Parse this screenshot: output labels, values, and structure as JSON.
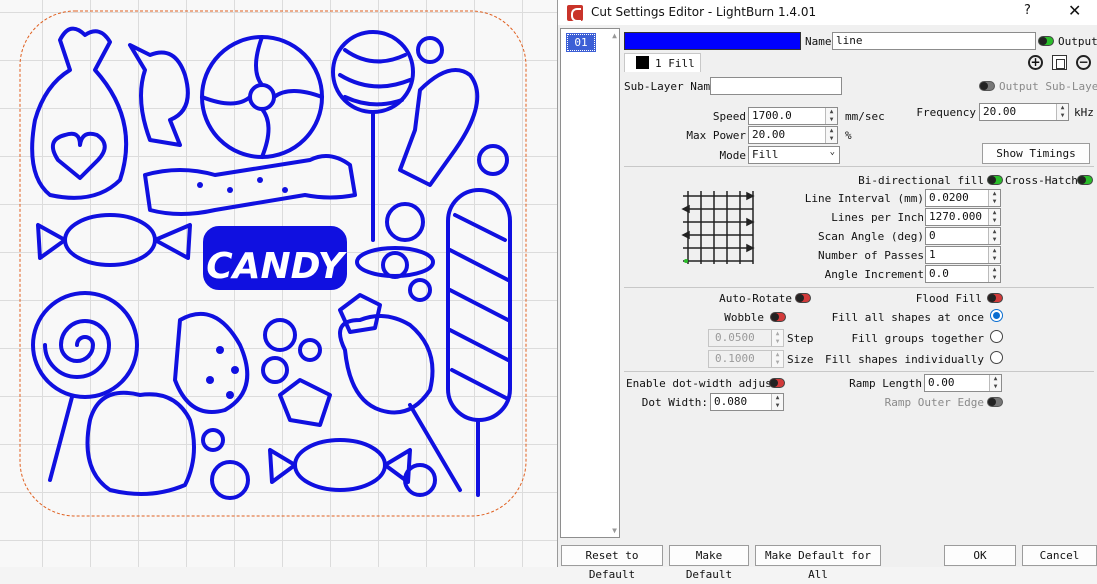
{
  "window": {
    "title": "Cut Settings Editor - LightBurn 1.4.01",
    "help": "?",
    "close": "✕"
  },
  "canvas": {
    "artwork_text": "CANDY"
  },
  "layer_list": {
    "items": [
      "01"
    ]
  },
  "layer": {
    "color": "#0000ff",
    "name_label": "Name",
    "name_value": "line",
    "output_label": "Output",
    "output_on": true
  },
  "sublayer": {
    "tab_label": "1 Fill",
    "name_label": "Sub-Layer Name",
    "name_value": "",
    "output_sublayer_label": "Output Sub-Layer"
  },
  "params": {
    "speed_label": "Speed",
    "speed_value": "1700.0",
    "speed_unit": "mm/sec",
    "max_power_label": "Max Power",
    "max_power_value": "20.00",
    "max_power_unit": "%",
    "mode_label": "Mode",
    "mode_value": "Fill",
    "frequency_label": "Frequency",
    "frequency_value": "20.00",
    "frequency_unit": "kHz",
    "show_timings": "Show Timings"
  },
  "fill": {
    "bidir_label": "Bi-directional fill",
    "crosshatch_label": "Cross-Hatch",
    "line_interval_label": "Line Interval (mm)",
    "line_interval_value": "0.0200",
    "lpi_label": "Lines per Inch",
    "lpi_value": "1270.000",
    "scan_angle_label": "Scan Angle (deg)",
    "scan_angle_value": "0",
    "passes_label": "Number of Passes",
    "passes_value": "1",
    "angle_inc_label": "Angle Increment",
    "angle_inc_value": "0.0"
  },
  "options": {
    "auto_rotate": "Auto-Rotate",
    "flood_fill": "Flood Fill",
    "wobble": "Wobble",
    "fill_all": "Fill all shapes at once",
    "step_value": "0.0500",
    "step_label": "Step",
    "fill_groups": "Fill groups together",
    "size_value": "0.1000",
    "size_label": "Size",
    "fill_individually": "Fill shapes individually",
    "dot_width_adjust": "Enable dot-width adjust",
    "ramp_length_label": "Ramp Length",
    "ramp_length_value": "0.00",
    "dot_width_label": "Dot Width:",
    "dot_width_value": "0.080",
    "ramp_outer_edge": "Ramp Outer Edge"
  },
  "footer": {
    "reset": "Reset to Default",
    "make_default": "Make Default",
    "make_default_all": "Make Default for All",
    "ok": "OK",
    "cancel": "Cancel"
  },
  "icons": [
    "add-icon",
    "copy-icon",
    "remove-icon",
    "lightburn-logo-icon",
    "close-icon",
    "help-icon"
  ]
}
